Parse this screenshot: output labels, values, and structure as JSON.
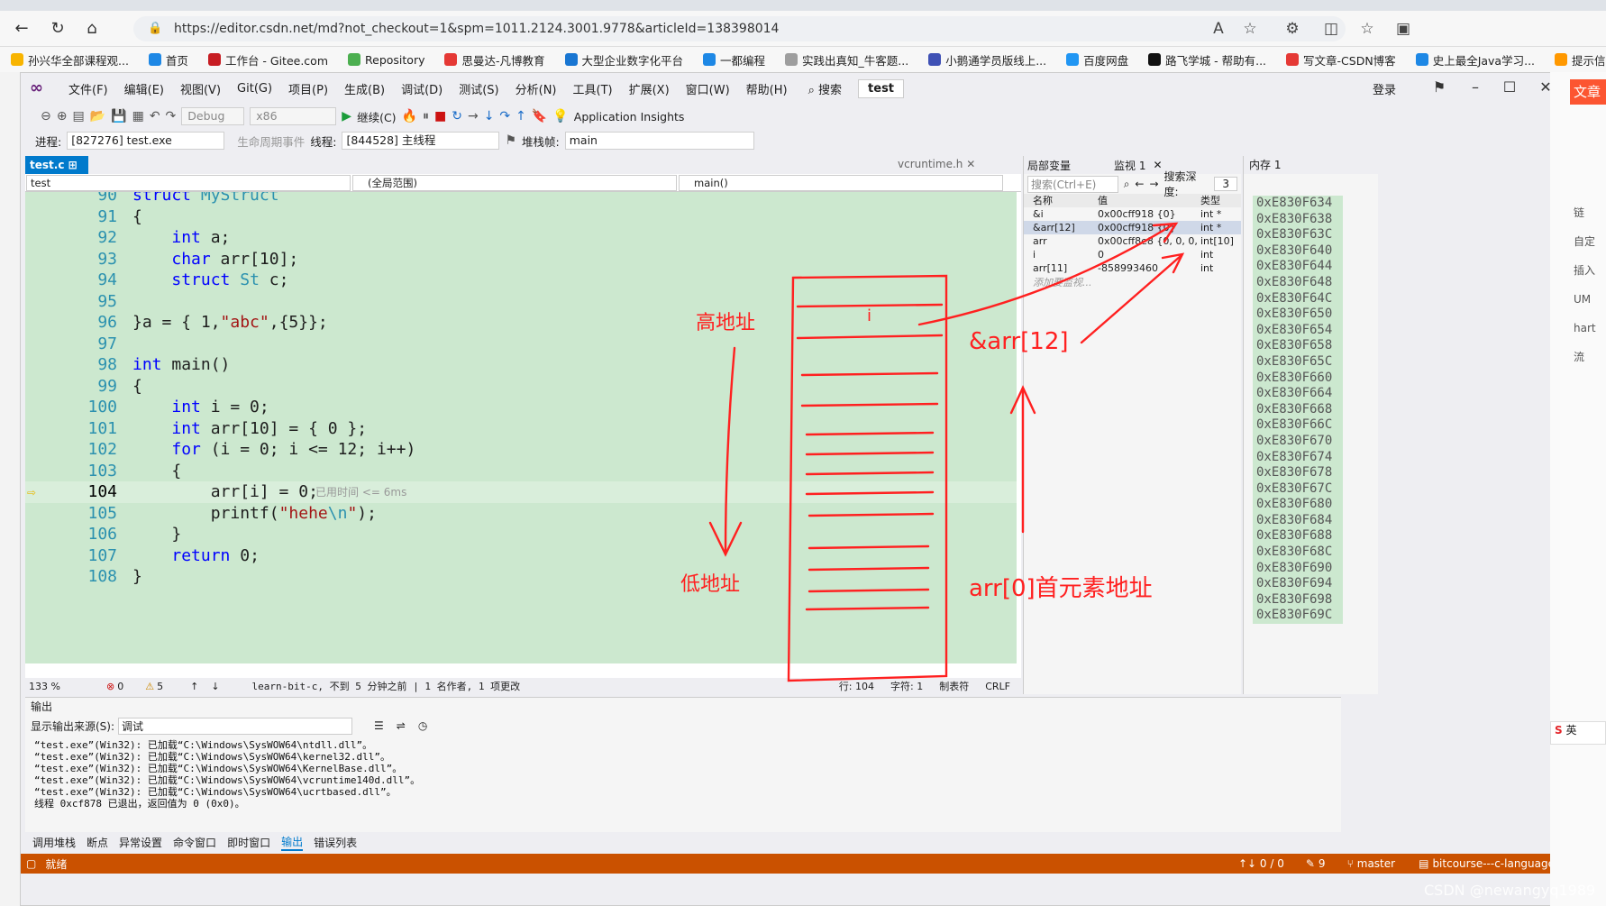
{
  "browser": {
    "url": "https://editor.csdn.net/md?not_checkout=1&spm=1011.2124.3001.9778&articleId=138398014",
    "bookmarks": [
      "孙兴华全部课程观...",
      "首页",
      "工作台 - Gitee.com",
      "Repository",
      "思曼达-凡博教育",
      "大型企业数字化平台",
      "一都编程",
      "实践出真知_牛客题...",
      "小鹅通学员版线上...",
      "百度网盘",
      "路飞学城 - 帮助有...",
      "写文章-CSDN博客",
      "史上最全Java学习...",
      "提示信息 - 火山软..."
    ]
  },
  "menu": {
    "items": [
      "文件(F)",
      "编辑(E)",
      "视图(V)",
      "Git(G)",
      "项目(P)",
      "生成(B)",
      "调试(D)",
      "测试(S)",
      "分析(N)",
      "工具(T)",
      "扩展(X)",
      "窗口(W)",
      "帮助(H)"
    ],
    "search": "搜索",
    "solution": "test",
    "login": "登录"
  },
  "toolbar": {
    "config": "Debug",
    "platform": "x86",
    "continue": "继续(C)",
    "insights": "Application Insights",
    "process_label": "进程:",
    "process": "[827276] test.exe",
    "lifecycle": "生命周期事件",
    "thread_label": "线程:",
    "thread": "[844528] 主线程",
    "stack_label": "堆栈帧:",
    "stack": "main"
  },
  "editor": {
    "active_tab": "test.c",
    "other_tab": "vcruntime.h",
    "nav_project": "test",
    "nav_scope": "(全局范围)",
    "nav_func": "main()",
    "lines": [
      {
        "n": "90",
        "code": "struct MyStruct"
      },
      {
        "n": "91",
        "code": "{"
      },
      {
        "n": "92",
        "code": "    int a;"
      },
      {
        "n": "93",
        "code": "    char arr[10];"
      },
      {
        "n": "94",
        "code": "    struct St c;"
      },
      {
        "n": "95",
        "code": ""
      },
      {
        "n": "96",
        "code": "}a = { 1,\"abc\",{5}};"
      },
      {
        "n": "97",
        "code": ""
      },
      {
        "n": "98",
        "code": "int main()"
      },
      {
        "n": "99",
        "code": "{"
      },
      {
        "n": "100",
        "code": "    int i = 0;"
      },
      {
        "n": "101",
        "code": "    int arr[10] = { 0 };"
      },
      {
        "n": "102",
        "code": "    for (i = 0; i <= 12; i++)"
      },
      {
        "n": "103",
        "code": "    {"
      },
      {
        "n": "104",
        "code": "        arr[i] = 0;"
      },
      {
        "n": "105",
        "code": "        printf(\"hehe\\n\");"
      },
      {
        "n": "106",
        "code": "    }"
      },
      {
        "n": "107",
        "code": "    return 0;"
      },
      {
        "n": "108",
        "code": "}"
      }
    ],
    "elapsed_hint": "已用时间 <= 6ms",
    "zoom": "133 %",
    "errors": "0",
    "warnings": "5",
    "git_info": "learn-bit-c, 不到 5 分钟之前 | 1 名作者, 1 项更改",
    "line_label": "行: 104",
    "char_label": "字符: 1",
    "tab_mode": "制表符",
    "eol": "CRLF"
  },
  "locals": {
    "tab_locals": "局部变量",
    "tab_watch": "监视 1",
    "search_placeholder": "搜索(Ctrl+E)",
    "depth_label": "搜索深度:",
    "depth": "3",
    "columns": [
      "名称",
      "值",
      "类型"
    ],
    "rows": [
      {
        "name": "&i",
        "value": "0x00cff918 {0}",
        "type": "int *"
      },
      {
        "name": "&arr[12]",
        "value": "0x00cff918 {0}",
        "type": "int *"
      },
      {
        "name": "arr",
        "value": "0x00cff8e8 {0, 0, 0, 0, ...",
        "type": "int[10]"
      },
      {
        "name": "i",
        "value": "0",
        "type": "int"
      },
      {
        "name": "arr[11]",
        "value": "-858993460",
        "type": "int"
      }
    ],
    "add_watch": "添加要监视..."
  },
  "memory": {
    "title": "内存 1",
    "addresses": [
      "0xE830F634",
      "0xE830F638",
      "0xE830F63C",
      "0xE830F640",
      "0xE830F644",
      "0xE830F648",
      "0xE830F64C",
      "0xE830F650",
      "0xE830F654",
      "0xE830F658",
      "0xE830F65C",
      "0xE830F660",
      "0xE830F664",
      "0xE830F668",
      "0xE830F66C",
      "0xE830F670",
      "0xE830F674",
      "0xE830F678",
      "0xE830F67C",
      "0xE830F680",
      "0xE830F684",
      "0xE830F688",
      "0xE830F68C",
      "0xE830F690",
      "0xE830F694",
      "0xE830F698",
      "0xE830F69C"
    ]
  },
  "output": {
    "title": "输出",
    "source_label": "显示输出来源(S):",
    "source": "调试",
    "lines": [
      "“test.exe”(Win32): 已加载“C:\\Windows\\SysWOW64\\ntdll.dll”。",
      "“test.exe”(Win32): 已加载“C:\\Windows\\SysWOW64\\kernel32.dll”。",
      "“test.exe”(Win32): 已加载“C:\\Windows\\SysWOW64\\KernelBase.dll”。",
      "“test.exe”(Win32): 已加载“C:\\Windows\\SysWOW64\\vcruntime140d.dll”。",
      "“test.exe”(Win32): 已加载“C:\\Windows\\SysWOW64\\ucrtbased.dll”。",
      "线程 0xcf878 已退出，返回值为 0 (0x0)。"
    ]
  },
  "bottom_tabs": [
    "调用堆栈",
    "断点",
    "异常设置",
    "命令窗口",
    "即时窗口",
    "输出",
    "错误列表"
  ],
  "status": {
    "ready": "就绪",
    "changes": "↑↓ 0 / 0",
    "edits": "9",
    "branch": "master",
    "repo": "bitcourse---c-language"
  },
  "annotations": {
    "high_addr": "高地址",
    "low_addr": "低地址",
    "arr12": "&arr[12]",
    "arr0": "arr[0]首元素地址",
    "i_mark": "i"
  },
  "watermark": "CSDN @newangyq1989",
  "right_panel": [
    "链",
    "自定",
    "插入UM",
    "hart流"
  ],
  "right_tab": "文章",
  "ime": "英"
}
